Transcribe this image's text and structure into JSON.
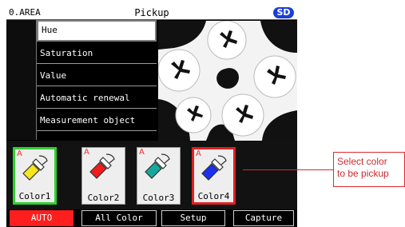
{
  "titlebar": {
    "area": "0.AREA",
    "title": "Pickup",
    "badge": "SD",
    "badge_color": "#1b3fd6"
  },
  "menu": {
    "items": [
      {
        "label": "Hue",
        "selected": true
      },
      {
        "label": "Saturation",
        "selected": false
      },
      {
        "label": "Value",
        "selected": false
      },
      {
        "label": "Automatic renewal",
        "selected": false
      },
      {
        "label": "Measurement object",
        "selected": false
      }
    ]
  },
  "colors": [
    {
      "label": "Color1",
      "marker": "A",
      "swatch": "#f3e61a",
      "selected": true,
      "outline": "#2fd12f"
    },
    {
      "label": "Color2",
      "marker": "A",
      "swatch": "#f01c1c",
      "selected": false
    },
    {
      "label": "Color3",
      "marker": "A",
      "swatch": "#15a89c",
      "selected": false
    },
    {
      "label": "Color4",
      "marker": "A",
      "swatch": "#1a2ff0",
      "selected": true,
      "outline": "#e02020"
    }
  ],
  "tabs": [
    {
      "label": "AUTO",
      "active": true
    },
    {
      "label": "All Color",
      "active": false
    },
    {
      "label": "Setup",
      "active": false
    },
    {
      "label": "Capture",
      "active": false
    }
  ],
  "callout": {
    "line1": "Select color",
    "line2": "to be pickup",
    "color": "#e0282c"
  }
}
